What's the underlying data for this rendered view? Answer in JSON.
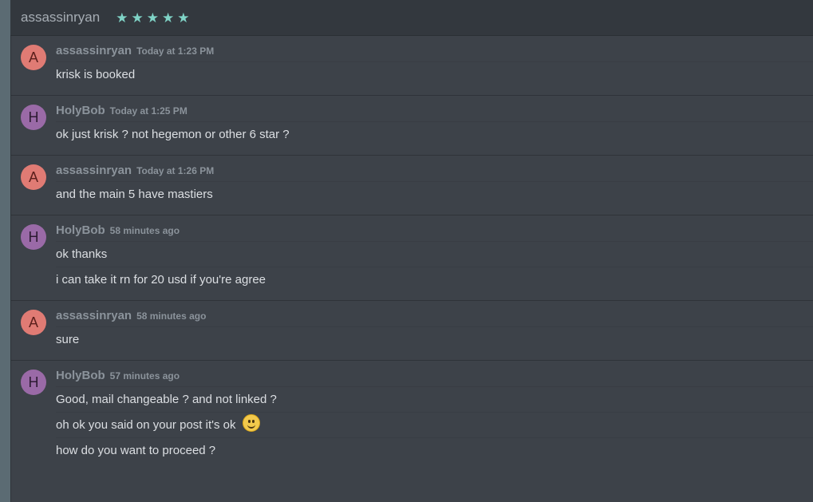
{
  "header": {
    "title": "assassinryan",
    "stars": [
      "★",
      "★",
      "★",
      "★",
      "★"
    ],
    "star_color": "#7fd3c6"
  },
  "messages": [
    {
      "avatar": "A",
      "author": "assassinryan",
      "time": "Today at 1:23 PM",
      "lines": [
        "krisk is booked"
      ]
    },
    {
      "avatar": "H",
      "author": "HolyBob",
      "time": "Today at 1:25 PM",
      "lines": [
        "ok just krisk ? not hegemon or other 6 star ?"
      ]
    },
    {
      "avatar": "A",
      "author": "assassinryan",
      "time": "Today at 1:26 PM",
      "lines": [
        "and the main 5 have mastiers"
      ]
    },
    {
      "avatar": "H",
      "author": "HolyBob",
      "time": "58 minutes ago",
      "lines": [
        "ok thanks",
        "i can take it rn for 20 usd if you're agree"
      ]
    },
    {
      "avatar": "A",
      "author": "assassinryan",
      "time": "58 minutes ago",
      "lines": [
        "sure"
      ]
    },
    {
      "avatar": "H",
      "author": "HolyBob",
      "time": "57 minutes ago",
      "lines": [
        "Good, mail changeable ? and not linked ?",
        "oh ok you said on your post it's ok",
        "how do you want to proceed ?"
      ]
    }
  ],
  "emoji": "slightly-smiling-face-icon"
}
